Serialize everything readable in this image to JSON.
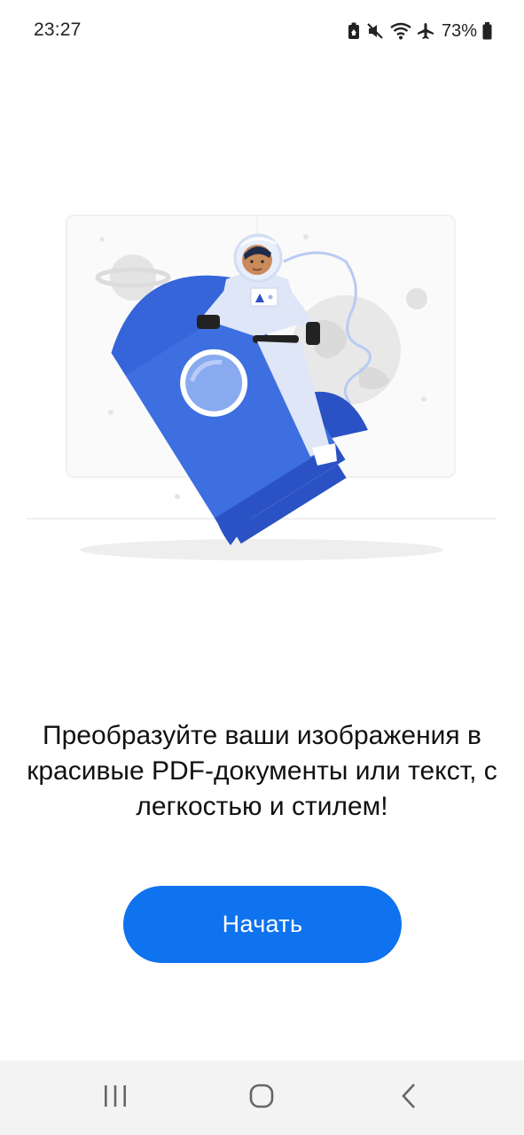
{
  "status_bar": {
    "time": "23:27",
    "battery_percent": "73%",
    "icons": [
      "battery-saver-icon",
      "mute-icon",
      "wifi-icon",
      "airplane-icon",
      "battery-icon"
    ]
  },
  "onboarding": {
    "message": "Преобразуйте ваши изображения в красивые PDF-документы или текст, с легкостью и стилем!",
    "start_label": "Начать"
  },
  "nav_bar": {
    "icons": [
      "recents-icon",
      "home-icon",
      "back-icon"
    ]
  },
  "colors": {
    "primary": "#0f72ee",
    "rocket": "#3d6fe0",
    "rocket_dark": "#2a52c4",
    "nav_background": "#f3f3f3"
  }
}
